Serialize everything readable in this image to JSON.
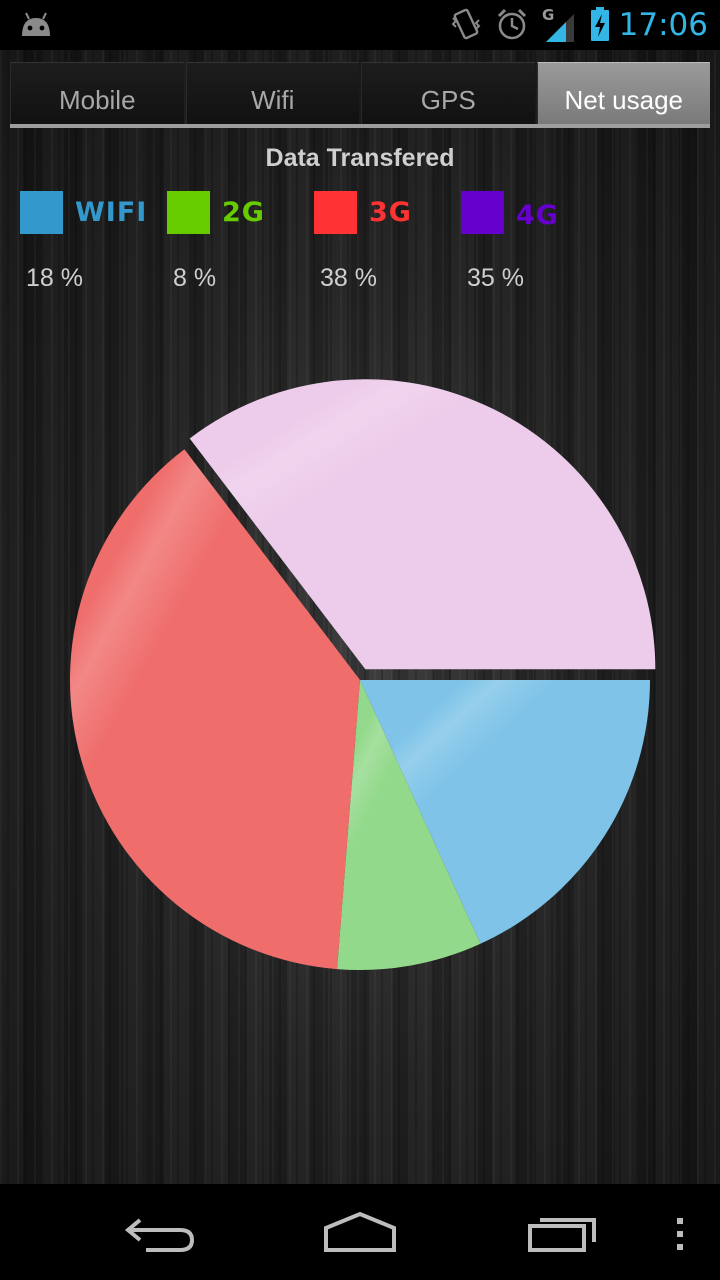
{
  "status_bar": {
    "time": "17:06",
    "network_type": "G",
    "icons": [
      "android-icon",
      "vibrate-icon",
      "alarm-icon",
      "signal-icon",
      "battery-charging-icon"
    ]
  },
  "tabs": [
    {
      "label": "Mobile",
      "active": false
    },
    {
      "label": "Wifi",
      "active": false
    },
    {
      "label": "GPS",
      "active": false
    },
    {
      "label": "Net usage",
      "active": true
    }
  ],
  "chart_data": {
    "type": "pie",
    "title": "Data Transfered",
    "categories": [
      "WIFI",
      "2G",
      "3G",
      "4G"
    ],
    "values": [
      18,
      8,
      38,
      35
    ],
    "value_labels": [
      "18 %",
      "8 %",
      "38 %",
      "35 %"
    ],
    "legend_colors": [
      "#3399cc",
      "#66cc00",
      "#ff3333",
      "#6600cc"
    ],
    "slice_colors": [
      "#7fc4e8",
      "#93d98b",
      "#ef6e6c",
      "#edcbea"
    ],
    "exploded": "4G",
    "legend": "top"
  },
  "nav_bar": {
    "icons": [
      "back-icon",
      "home-icon",
      "recent-apps-icon",
      "menu-icon"
    ]
  }
}
